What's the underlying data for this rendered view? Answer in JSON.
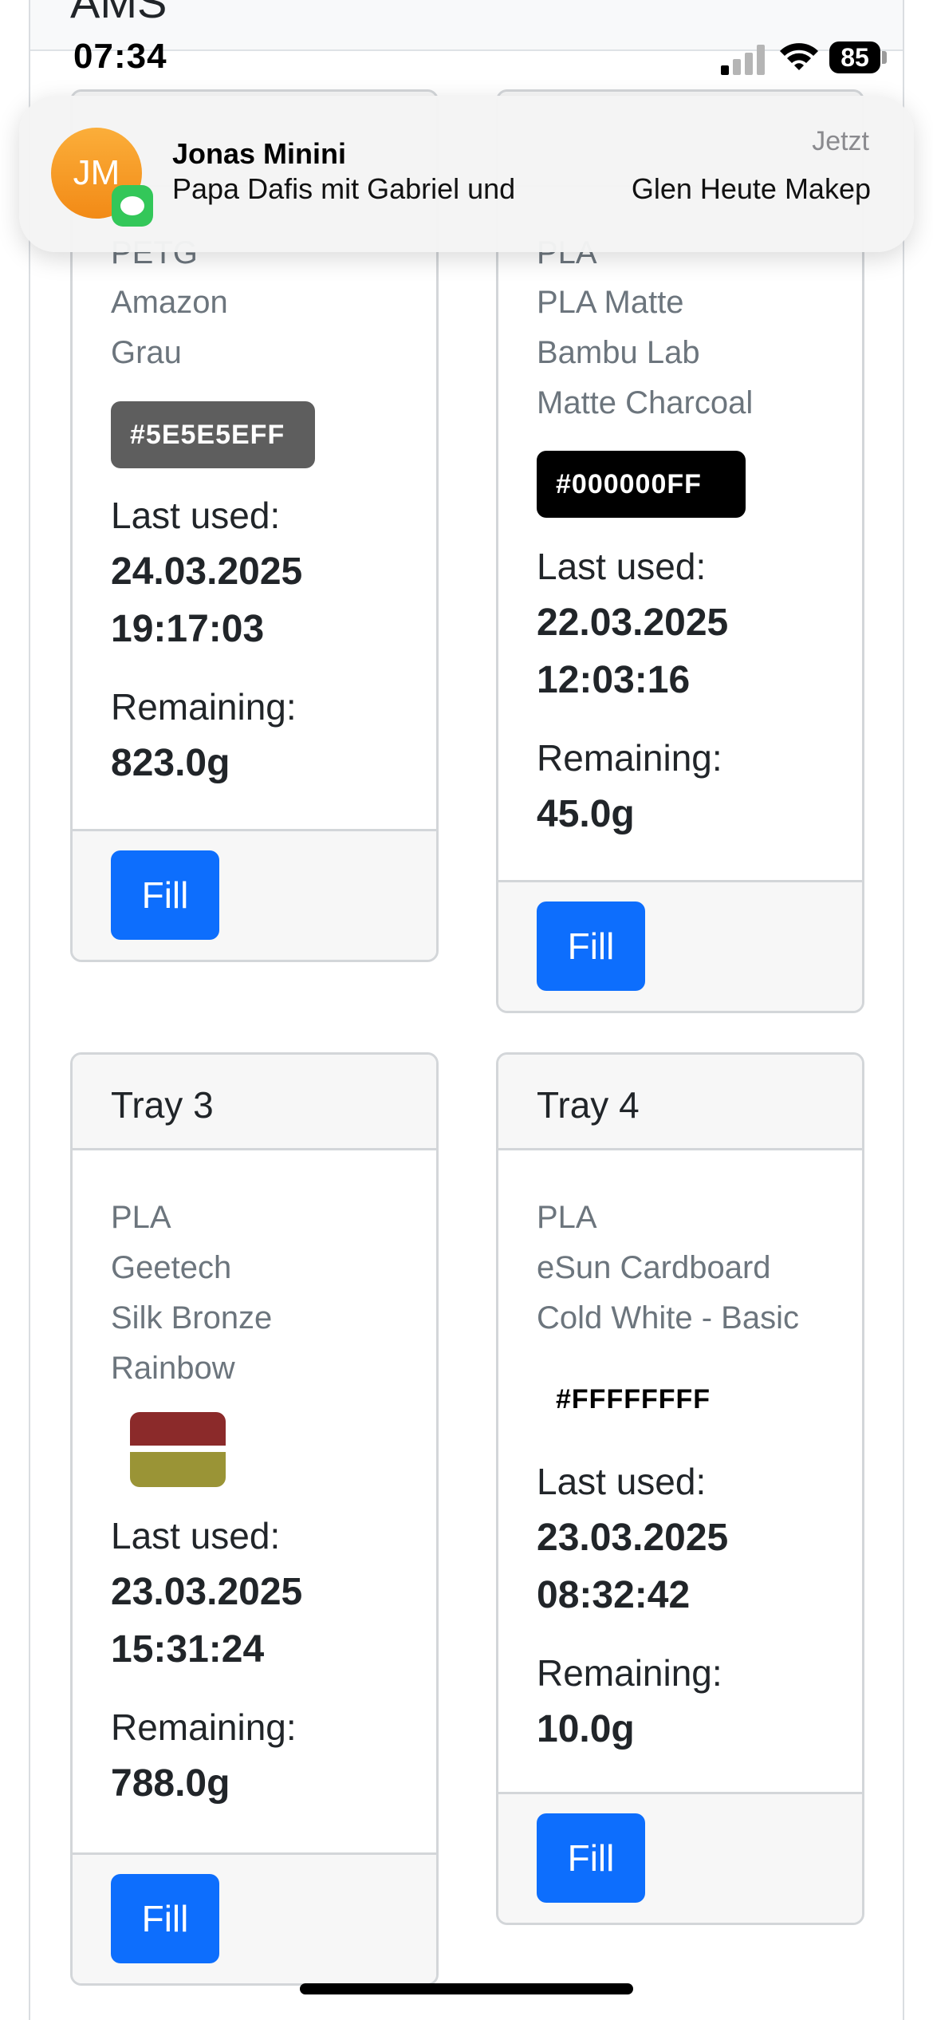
{
  "page": {
    "heading": "AMS"
  },
  "status_bar": {
    "time": "07:34",
    "battery": "85"
  },
  "notification": {
    "avatar_initials": "JM",
    "sender": "Jonas Minini",
    "time": "Jetzt",
    "body_left": "Papa Dafis mit Gabriel und",
    "body_right": "Glen Heute Makep"
  },
  "trays": [
    {
      "type": "PETG",
      "brand": "Amazon",
      "color_name": "Grau",
      "color_hex_label": "#5E5E5EFF",
      "last_used_label": "Last used:",
      "last_used_date": "24.03.2025",
      "last_used_time": "19:17:03",
      "remaining_label": "Remaining:",
      "remaining": "823.0g",
      "fill_label": "Fill"
    },
    {
      "type": "PLA",
      "sub_type": "PLA Matte",
      "brand": "Bambu Lab",
      "color_name": "Matte Charcoal",
      "color_hex_label": "#000000FF",
      "last_used_label": "Last used:",
      "last_used_date": "22.03.2025",
      "last_used_time": "12:03:16",
      "remaining_label": "Remaining:",
      "remaining": "45.0g",
      "fill_label": "Fill"
    },
    {
      "title": "Tray 3",
      "type": "PLA",
      "brand": "Geetech",
      "color_name": "Silk Bronze",
      "color_name_2": "Rainbow",
      "swatch_colors": [
        "#8b2a2a",
        "#9a9436"
      ],
      "last_used_label": "Last used:",
      "last_used_date": "23.03.2025",
      "last_used_time": "15:31:24",
      "remaining_label": "Remaining:",
      "remaining": "788.0g",
      "fill_label": "Fill"
    },
    {
      "title": "Tray 4",
      "type": "PLA",
      "brand": "eSun Cardboard",
      "color_name": "Cold White - Basic",
      "color_hex_label": "#FFFFFFFF",
      "last_used_label": "Last used:",
      "last_used_date": "23.03.2025",
      "last_used_time": "08:32:42",
      "remaining_label": "Remaining:",
      "remaining": "10.0g",
      "fill_label": "Fill"
    }
  ],
  "colors": {
    "fill_button": "#0d6efd",
    "swatch_grey": "#5e5e5e",
    "swatch_black": "#000000"
  }
}
